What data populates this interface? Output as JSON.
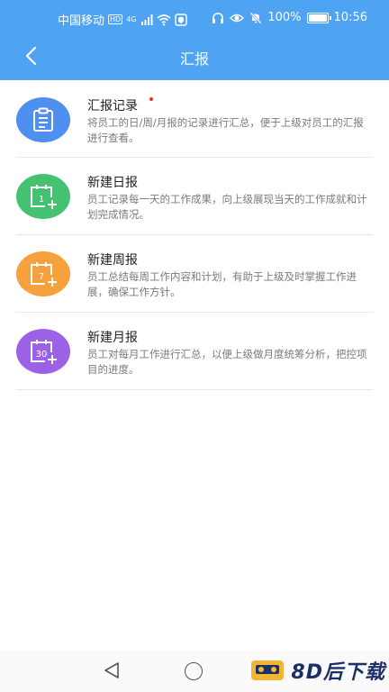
{
  "status": {
    "carrier": "中国移动",
    "hd": "HD",
    "net": "4G",
    "battery_percent": "100%",
    "time": "10:56",
    "battery_level": 1.0
  },
  "header": {
    "title": "汇报"
  },
  "items": [
    {
      "title": "汇报记录",
      "desc": "将员工的日/周/月报的记录进行汇总，便于上级对员工的汇报进行查看。",
      "color": "#4f8ff0",
      "icon": "clipboard-icon",
      "unread": true
    },
    {
      "title": "新建日报",
      "desc": "员工记录每一天的工作成果，向上级展现当天的工作成就和计划完成情况。",
      "color": "#45c271",
      "icon": "calendar-add-icon",
      "icon_number": "1"
    },
    {
      "title": "新建周报",
      "desc": "员工总结每周工作内容和计划，有助于上级及时掌握工作进展，确保工作方针。",
      "color": "#f5a23e",
      "icon": "calendar-add-icon",
      "icon_number": "7"
    },
    {
      "title": "新建月报",
      "desc": "员工对每月工作进行汇总，以便上级做月度统筹分析，把控项目的进度。",
      "color": "#9b62e6",
      "icon": "calendar-add-icon",
      "icon_number": "30"
    }
  ],
  "watermark": {
    "text": "8D后下载"
  }
}
